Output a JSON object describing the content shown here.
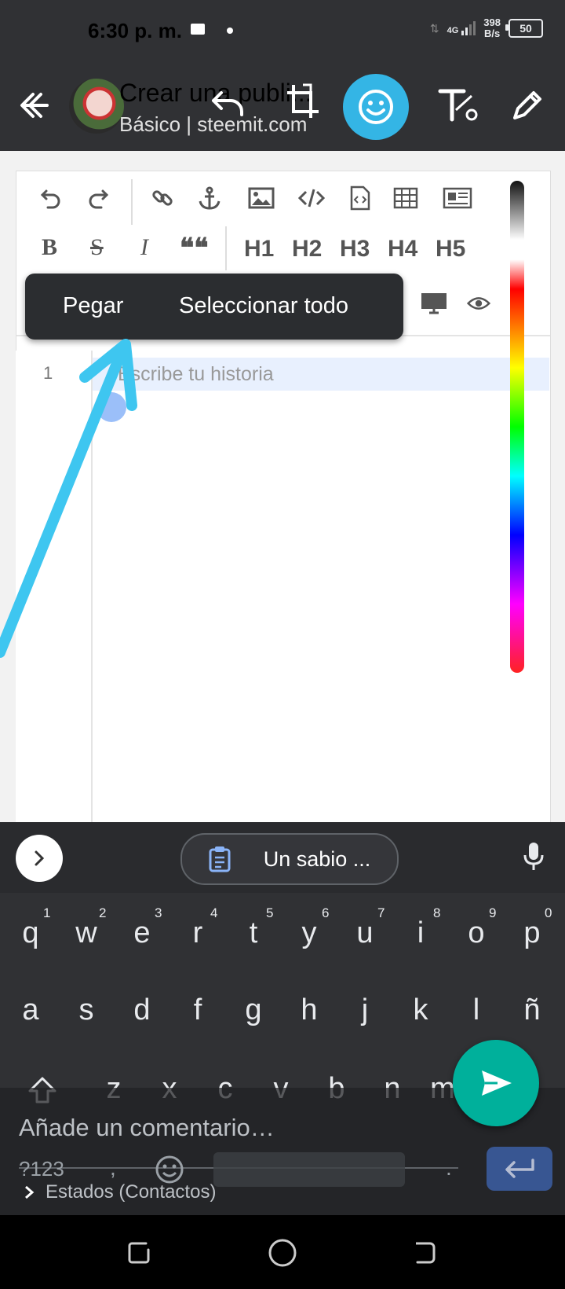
{
  "status_bar": {
    "time": "6:30 p. m.",
    "network": "4G",
    "speed_value": "398",
    "speed_unit": "B/s",
    "battery": "50"
  },
  "header": {
    "title": "Crear una publi...",
    "subtitle": "Básico | steemit.com",
    "icons": [
      "back-arrow-icon",
      "undo-icon",
      "crop-rotate-icon",
      "emoji-icon",
      "text-tool-icon",
      "pencil-icon"
    ]
  },
  "editor": {
    "toolbar_row1": [
      "undo-icon",
      "redo-icon",
      "link-icon",
      "anchor-icon",
      "image-icon",
      "code-icon",
      "code-file-icon",
      "table-icon",
      "embed-icon"
    ],
    "toolbar_row2": {
      "bold": "B",
      "strike": "S",
      "italic": "I",
      "quote": "❝❝",
      "headings": [
        "H1",
        "H2",
        "H3",
        "H4",
        "H5"
      ]
    },
    "line_number": "1",
    "placeholder": "Escribe tu historia"
  },
  "context_menu": {
    "paste": "Pegar",
    "select_all": "Seleccionar todo"
  },
  "keyboard": {
    "suggestion": "Un sabio ...",
    "row1": [
      "q",
      "w",
      "e",
      "r",
      "t",
      "y",
      "u",
      "i",
      "o",
      "p"
    ],
    "row1_hints": [
      "1",
      "2",
      "3",
      "4",
      "5",
      "6",
      "7",
      "8",
      "9",
      "0"
    ],
    "row2": [
      "a",
      "s",
      "d",
      "f",
      "g",
      "h",
      "j",
      "k",
      "l",
      "ñ"
    ],
    "row3": [
      "z",
      "x",
      "c",
      "v",
      "b",
      "n",
      "m"
    ],
    "symbols": "?123",
    "comma": ",",
    "period": "."
  },
  "composer": {
    "placeholder": "Añade un comentario…",
    "states": "Estados (Contactos)"
  },
  "colors": {
    "accent": "#34b5e5",
    "send": "#00b09b",
    "arrow": "#3ec6f0"
  }
}
